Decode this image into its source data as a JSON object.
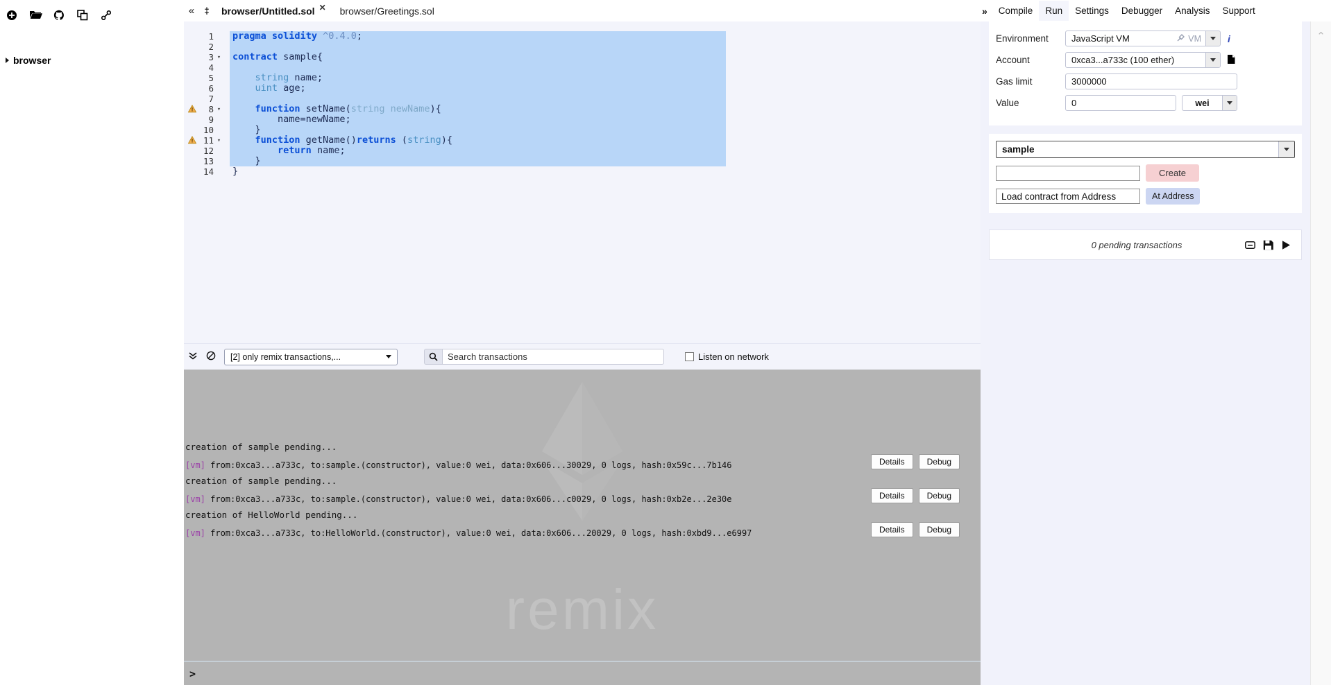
{
  "filepanel": {
    "icons": [
      {
        "name": "create-new-file-icon",
        "glyph": "plus-circle"
      },
      {
        "name": "open-folder-icon",
        "glyph": "folder-open"
      },
      {
        "name": "github-icon",
        "glyph": "github"
      },
      {
        "name": "copy-files-icon",
        "glyph": "copy"
      },
      {
        "name": "link-icon",
        "glyph": "link"
      }
    ],
    "tree_root": "browser"
  },
  "tabs": {
    "collapse_glyph": "«",
    "stack_glyph": "‡",
    "items": [
      {
        "label": "browser/Untitled.sol",
        "active": true,
        "closable": true,
        "close_glyph": "✕"
      },
      {
        "label": "browser/Greetings.sol",
        "active": false,
        "closable": false
      }
    ]
  },
  "topmenu": {
    "expand_glyph": "»",
    "items": [
      {
        "label": "Compile",
        "active": false
      },
      {
        "label": "Run",
        "active": true
      },
      {
        "label": "Settings",
        "active": false
      },
      {
        "label": "Debugger",
        "active": false
      },
      {
        "label": "Analysis",
        "active": false
      },
      {
        "label": "Support",
        "active": false
      }
    ]
  },
  "editor": {
    "selection_color": "#b8d6f8",
    "lines": [
      {
        "n": "1",
        "warn": false,
        "fold": false,
        "selected": true,
        "tokens": [
          {
            "t": "pragma",
            "c": "kw"
          },
          {
            "t": " ",
            "c": "pl"
          },
          {
            "t": "solidity",
            "c": "kw"
          },
          {
            "t": " ",
            "c": "pl"
          },
          {
            "t": "^0.4.0",
            "c": "num"
          },
          {
            "t": ";",
            "c": "pl"
          }
        ]
      },
      {
        "n": "2",
        "warn": false,
        "fold": false,
        "selected": true,
        "tokens": []
      },
      {
        "n": "3",
        "warn": false,
        "fold": true,
        "selected": true,
        "tokens": [
          {
            "t": "contract",
            "c": "kw"
          },
          {
            "t": " sample{",
            "c": "pl"
          }
        ]
      },
      {
        "n": "4",
        "warn": false,
        "fold": false,
        "selected": true,
        "tokens": []
      },
      {
        "n": "5",
        "warn": false,
        "fold": false,
        "selected": true,
        "tokens": [
          {
            "t": "    ",
            "c": "pl"
          },
          {
            "t": "string",
            "c": "typ"
          },
          {
            "t": " name;",
            "c": "pl"
          }
        ]
      },
      {
        "n": "6",
        "warn": false,
        "fold": false,
        "selected": true,
        "tokens": [
          {
            "t": "    ",
            "c": "pl"
          },
          {
            "t": "uint",
            "c": "typ"
          },
          {
            "t": " age;",
            "c": "pl"
          }
        ]
      },
      {
        "n": "7",
        "warn": false,
        "fold": false,
        "selected": true,
        "tokens": []
      },
      {
        "n": "8",
        "warn": true,
        "fold": true,
        "selected": true,
        "tokens": [
          {
            "t": "    ",
            "c": "pl"
          },
          {
            "t": "function",
            "c": "kw"
          },
          {
            "t": " setName(",
            "c": "pl"
          },
          {
            "t": "string newName",
            "c": "arg"
          },
          {
            "t": "){",
            "c": "pl"
          }
        ]
      },
      {
        "n": "9",
        "warn": false,
        "fold": false,
        "selected": true,
        "tokens": [
          {
            "t": "        name=newName;",
            "c": "pl"
          }
        ]
      },
      {
        "n": "10",
        "warn": false,
        "fold": false,
        "selected": true,
        "tokens": [
          {
            "t": "    }",
            "c": "pl"
          }
        ]
      },
      {
        "n": "11",
        "warn": true,
        "fold": true,
        "selected": true,
        "tokens": [
          {
            "t": "    ",
            "c": "pl"
          },
          {
            "t": "function",
            "c": "kw"
          },
          {
            "t": " getName()",
            "c": "pl"
          },
          {
            "t": "returns",
            "c": "kw"
          },
          {
            "t": " (",
            "c": "pl"
          },
          {
            "t": "string",
            "c": "typ"
          },
          {
            "t": "){",
            "c": "pl"
          }
        ]
      },
      {
        "n": "12",
        "warn": false,
        "fold": false,
        "selected": true,
        "tokens": [
          {
            "t": "        ",
            "c": "pl"
          },
          {
            "t": "return",
            "c": "kw"
          },
          {
            "t": " name;",
            "c": "pl"
          }
        ]
      },
      {
        "n": "13",
        "warn": false,
        "fold": false,
        "selected": true,
        "tokens": [
          {
            "t": "    }",
            "c": "pl"
          }
        ]
      },
      {
        "n": "14",
        "warn": false,
        "fold": false,
        "selected": false,
        "tokens": [
          {
            "t": "}",
            "c": "pl"
          }
        ]
      }
    ]
  },
  "terminal_bar": {
    "collapse_glyph": "⌄⌄",
    "clear_glyph": "⊘",
    "filter_value": "[2] only remix transactions,...",
    "search_icon": "search-icon",
    "search_placeholder": "Search transactions",
    "listen_label": "Listen on network",
    "listen_checked": false
  },
  "terminal": {
    "watermark": "remix",
    "entries": [
      {
        "title": "creation of sample pending...",
        "tag": "[vm]",
        "detail": "from:0xca3...a733c, to:sample.(constructor), value:0 wei, data:0x606...30029, 0 logs, hash:0x59c...7b146",
        "details_label": "Details",
        "debug_label": "Debug"
      },
      {
        "title": "creation of sample pending...",
        "tag": "[vm]",
        "detail": "from:0xca3...a733c, to:sample.(constructor), value:0 wei, data:0x606...c0029, 0 logs, hash:0xb2e...2e30e",
        "details_label": "Details",
        "debug_label": "Debug"
      },
      {
        "title": "creation of HelloWorld pending...",
        "tag": "[vm]",
        "detail": "from:0xca3...a733c, to:HelloWorld.(constructor), value:0 wei, data:0x606...20029, 0 logs, hash:0xbd9...e6997",
        "details_label": "Details",
        "debug_label": "Debug"
      }
    ],
    "prompt_glyph": ">"
  },
  "runpanel": {
    "environment": {
      "label": "Environment",
      "value": "JavaScript VM",
      "badge": "VM",
      "info_glyph": "i"
    },
    "account": {
      "label": "Account",
      "value": "0xca3...a733c (100 ether)",
      "copy_icon": "copy-icon"
    },
    "gaslimit": {
      "label": "Gas limit",
      "value": "3000000"
    },
    "value": {
      "label": "Value",
      "value": "0",
      "unit": "wei"
    },
    "contract": {
      "selected": "sample"
    },
    "create": {
      "input_value": "",
      "button_label": "Create"
    },
    "at_address": {
      "input_value": "Load contract from Address",
      "button_label": "At Address"
    },
    "pending": {
      "text": "0 pending transactions",
      "icons": [
        {
          "name": "minimize-icon"
        },
        {
          "name": "save-icon"
        },
        {
          "name": "run-icon"
        }
      ]
    },
    "scroll_chevron": "⌃"
  }
}
